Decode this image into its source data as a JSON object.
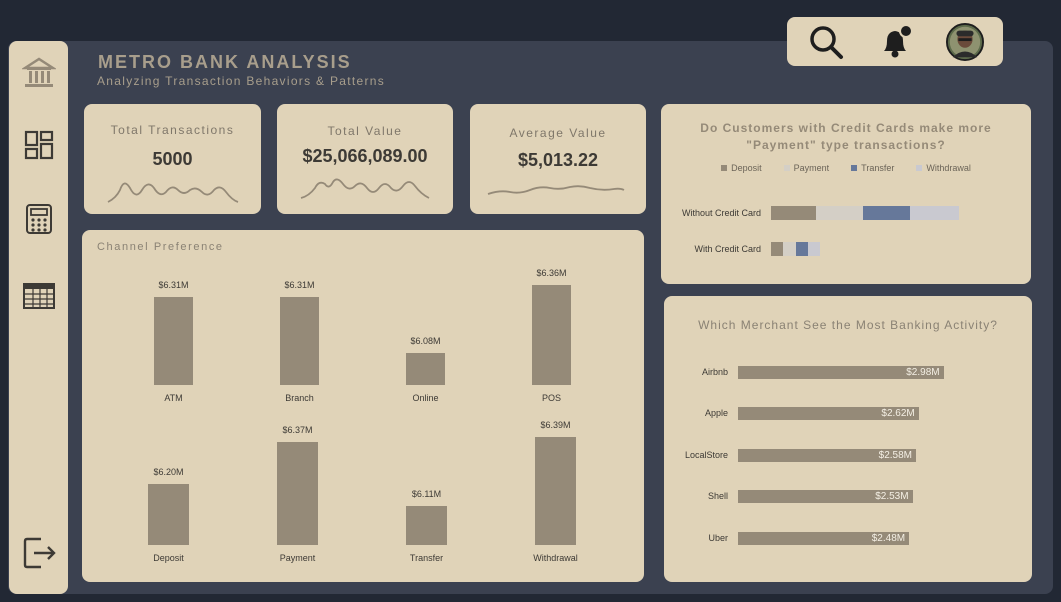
{
  "header": {
    "title": "METRO BANK ANALYSIS",
    "subtitle": "Analyzing Transaction Behaviors & Patterns"
  },
  "sidebar": {
    "items": [
      {
        "icon": "bank-icon"
      },
      {
        "icon": "dashboard-icon"
      },
      {
        "icon": "calculator-icon"
      },
      {
        "icon": "table-icon"
      },
      {
        "icon": "logout-icon"
      }
    ]
  },
  "topbar": {
    "icons": [
      "search-icon",
      "bell-icon",
      "avatar"
    ],
    "notification_dot": true
  },
  "kpis": [
    {
      "label": "Total Transactions",
      "value": "5000"
    },
    {
      "label": "Total Value",
      "value": "$25,066,089.00"
    },
    {
      "label": "Average Value",
      "value": "$5,013.22"
    }
  ],
  "channel": {
    "title": "Channel Preference"
  },
  "credit": {
    "title_line1": "Do Customers with Credit Cards make more",
    "title_line2": "\"Payment\" type transactions?"
  },
  "merchant": {
    "title": "Which Merchant See the Most Banking Activity?"
  },
  "colors": {
    "background": "#222834",
    "panel": "#3b4150",
    "card": "#e0d3b8",
    "bar": "#958a78",
    "deposit": "#958a78",
    "payment": "#d4cfc6",
    "transfer": "#66789a",
    "withdrawal": "#c9c9d0"
  },
  "chart_data": [
    {
      "type": "bar",
      "title": "Channel Preference",
      "categories": [
        "ATM",
        "Branch",
        "Online",
        "POS"
      ],
      "values": [
        6.31,
        6.31,
        6.08,
        6.36
      ],
      "labels": [
        "$6.31M",
        "$6.31M",
        "$6.08M",
        "$6.36M"
      ],
      "unit": "M"
    },
    {
      "type": "bar",
      "categories": [
        "Deposit",
        "Payment",
        "Transfer",
        "Withdrawal"
      ],
      "values": [
        6.2,
        6.37,
        6.11,
        6.39
      ],
      "labels": [
        "$6.20M",
        "$6.37M",
        "$6.11M",
        "$6.39M"
      ],
      "unit": "M"
    },
    {
      "type": "bar",
      "orientation": "horizontal",
      "stacked": true,
      "title": "Do Customers with Credit Cards make more \"Payment\" type transactions?",
      "categories": [
        "Without Credit Card",
        "With Credit Card"
      ],
      "series": [
        {
          "name": "Deposit",
          "values": [
            45,
            12
          ]
        },
        {
          "name": "Payment",
          "values": [
            47,
            13
          ]
        },
        {
          "name": "Transfer",
          "values": [
            47,
            12
          ]
        },
        {
          "name": "Withdrawal",
          "values": [
            49,
            12
          ]
        }
      ],
      "legend": "top"
    },
    {
      "type": "bar",
      "orientation": "horizontal",
      "title": "Which Merchant See the Most Banking Activity?",
      "categories": [
        "Airbnb",
        "Apple",
        "LocalStore",
        "Shell",
        "Uber"
      ],
      "values": [
        2.98,
        2.62,
        2.58,
        2.53,
        2.48
      ],
      "labels": [
        "$2.98M",
        "$2.62M",
        "$2.58M",
        "$2.53M",
        "$2.48M"
      ],
      "unit": "M"
    }
  ]
}
